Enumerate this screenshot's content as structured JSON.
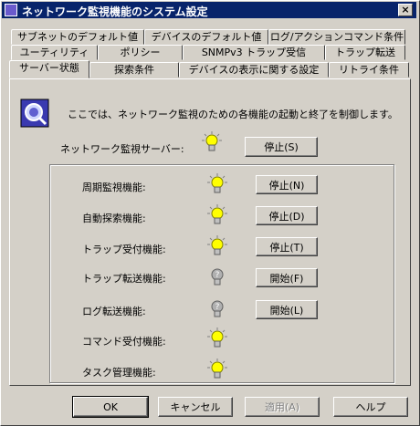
{
  "window": {
    "title": "ネットワーク監視機能のシステム設定",
    "close_label": "×"
  },
  "tabs_row1": [
    "サブネットのデフォルト値",
    "デバイスのデフォルト値",
    "ログ/アクションコマンド条件"
  ],
  "tabs_row2": [
    "ユーティリティ",
    "ポリシー",
    "SNMPv3 トラップ受信",
    "トラップ転送"
  ],
  "tabs_row3": [
    "サーバー状態",
    "探索条件",
    "デバイスの表示に関する設定",
    "リトライ条件"
  ],
  "info": {
    "text": "ここでは、ネットワーク監視のための各機能の起動と終了を制御します。"
  },
  "server": {
    "label": "ネットワーク監視サーバー:",
    "state": "on",
    "button": "停止(S)"
  },
  "functions": [
    {
      "label": "周期監視機能:",
      "state": "on",
      "button": "停止(N)"
    },
    {
      "label": "自動探索機能:",
      "state": "on",
      "button": "停止(D)"
    },
    {
      "label": "トラップ受付機能:",
      "state": "on",
      "button": "停止(T)"
    },
    {
      "label": "トラップ転送機能:",
      "state": "off",
      "button": "開始(F)"
    },
    {
      "label": "ログ転送機能:",
      "state": "off",
      "button": "開始(L)"
    },
    {
      "label": "コマンド受付機能:",
      "state": "on",
      "button": ""
    },
    {
      "label": "タスク管理機能:",
      "state": "on",
      "button": ""
    }
  ],
  "footer": {
    "ok": "OK",
    "cancel": "キャンセル",
    "apply": "適用(A)",
    "help": "ヘルプ"
  },
  "colors": {
    "titlebar": "#08246b",
    "bulb_on": "#ffff00",
    "bulb_off": "#b0b0b0"
  }
}
